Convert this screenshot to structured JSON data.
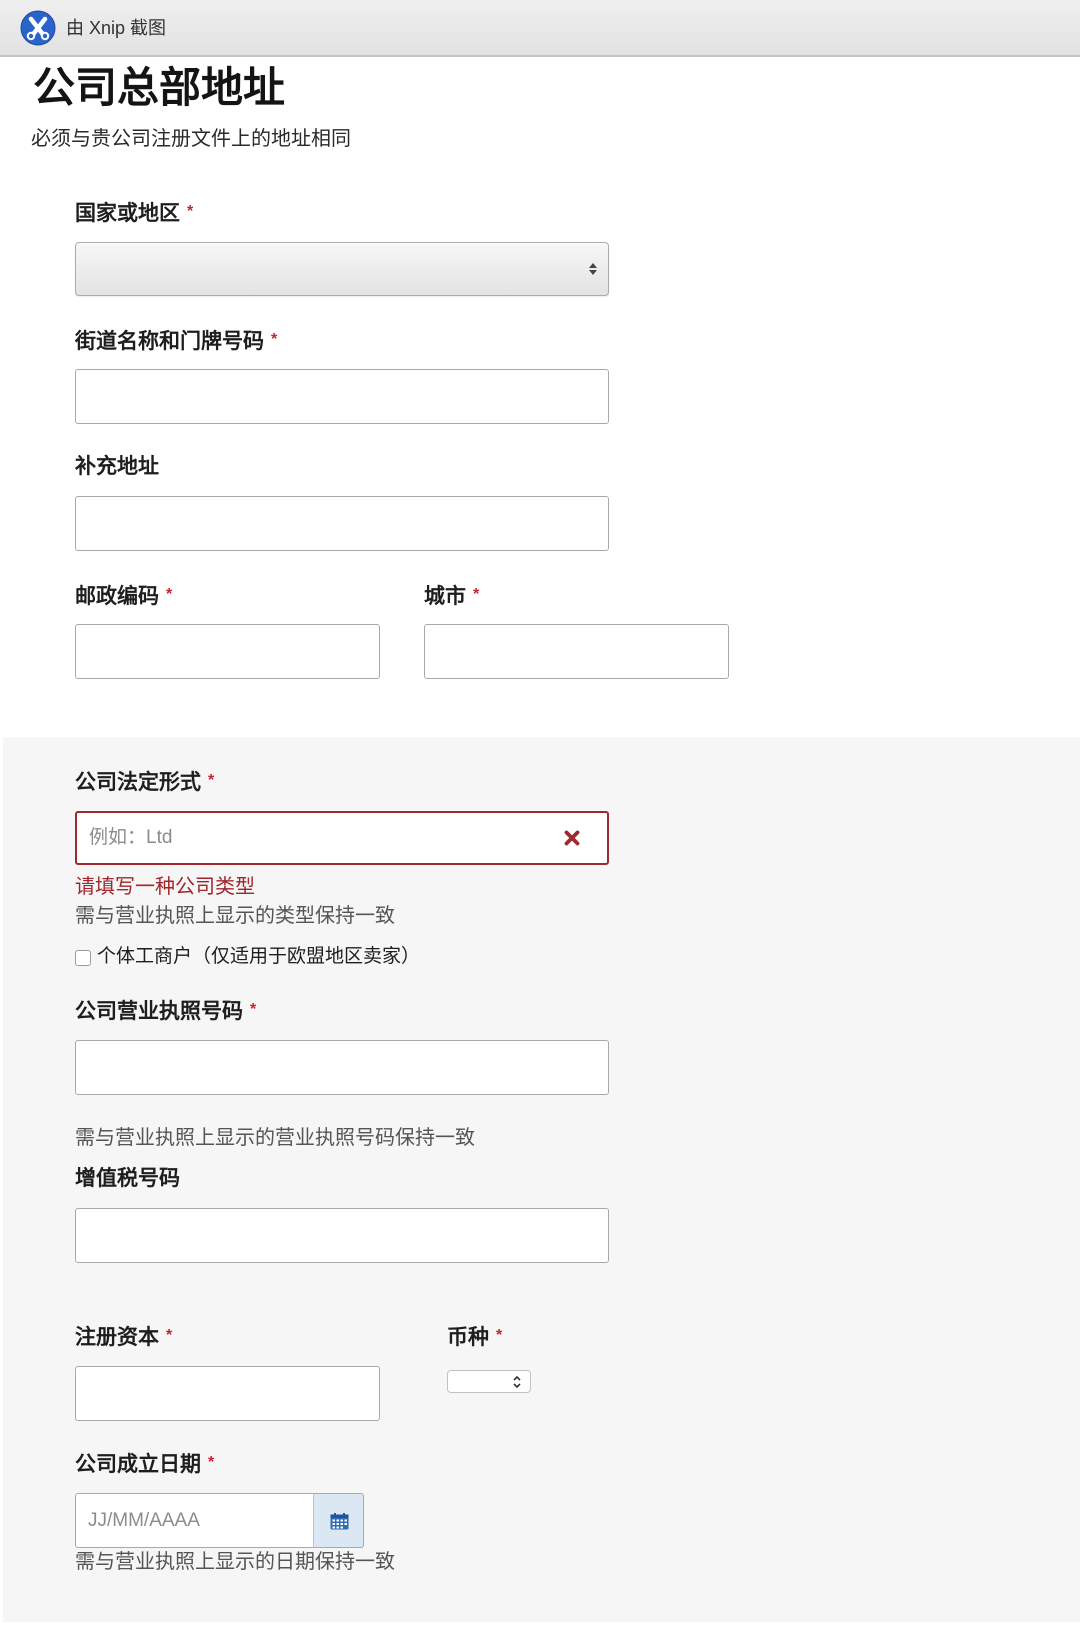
{
  "capture_bar": {
    "app_icon": "xnip-logo-icon",
    "label": "由 Xnip 截图"
  },
  "page": {
    "title": "公司总部地址",
    "subtitle": "必须与贵公司注册文件上的地址相同"
  },
  "required_marker": "*",
  "address": {
    "country": {
      "label": "国家或地区",
      "selected": "",
      "icon": "sort-arrows-icon"
    },
    "street": {
      "label": "街道名称和门牌号码",
      "value": ""
    },
    "address_line_2": {
      "label": "补充地址",
      "value": ""
    },
    "postal_code": {
      "label": "邮政编码",
      "value": ""
    },
    "city": {
      "label": "城市",
      "value": ""
    }
  },
  "company": {
    "legal_form": {
      "label": "公司法定形式",
      "value": "",
      "placeholder": "例如：Ltd",
      "clear_icon": "close-icon",
      "error": "请填写一种公司类型",
      "help": "需与营业执照上显示的类型保持一致"
    },
    "sole_trader": {
      "label": "个体工商户（仅适用于欧盟地区卖家）",
      "checked": false
    },
    "license_number": {
      "label": "公司营业执照号码",
      "value": "",
      "help": "需与营业执照上显示的营业执照号码保持一致"
    },
    "vat_number": {
      "label": "增值税号码",
      "value": ""
    },
    "registered_capital": {
      "label": "注册资本",
      "value": ""
    },
    "currency": {
      "label": "币种",
      "selected": "",
      "icon": "chevron-up-down-icon"
    },
    "founding_date": {
      "label": "公司成立日期",
      "value": "",
      "placeholder": "JJ/MM/AAAA",
      "calendar_icon": "calendar-icon",
      "help": "需与营业执照上显示的日期保持一致"
    }
  },
  "colors": {
    "required": "#c8242c",
    "error_text": "#a0262c",
    "error_border": "#9e2a30",
    "section_background": "#f6f6f6",
    "calendar_button": "#dbe7f3",
    "logo_blue": "#2a63c9"
  }
}
